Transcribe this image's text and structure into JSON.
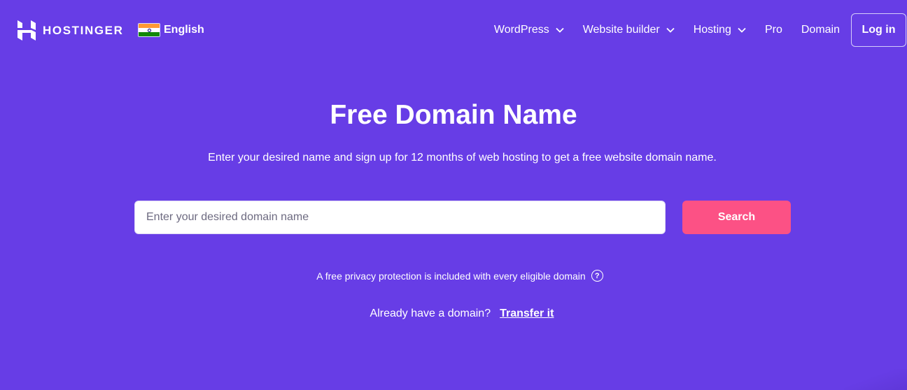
{
  "header": {
    "brand": "HOSTINGER",
    "language": {
      "flag": "india-flag",
      "label": "English"
    },
    "nav": [
      {
        "label": "WordPress",
        "has_dropdown": true
      },
      {
        "label": "Website builder",
        "has_dropdown": true
      },
      {
        "label": "Hosting",
        "has_dropdown": true
      },
      {
        "label": "Pro",
        "has_dropdown": false
      },
      {
        "label": "Domain",
        "has_dropdown": false
      }
    ],
    "login_label": "Log in"
  },
  "hero": {
    "title": "Free Domain Name",
    "subtitle": "Enter your desired name and sign up for 12 months of web hosting to get a free website domain name.",
    "search": {
      "placeholder": "Enter your desired domain name",
      "value": "",
      "button_label": "Search"
    },
    "privacy_note": "A free privacy protection is included with every eligible domain",
    "help_icon": "question-circle-icon",
    "help_glyph": "?",
    "transfer_prompt": "Already have a domain?",
    "transfer_link": "Transfer it"
  },
  "colors": {
    "background": "#673de6",
    "search_button": "#fc5185",
    "text": "#ffffff"
  }
}
